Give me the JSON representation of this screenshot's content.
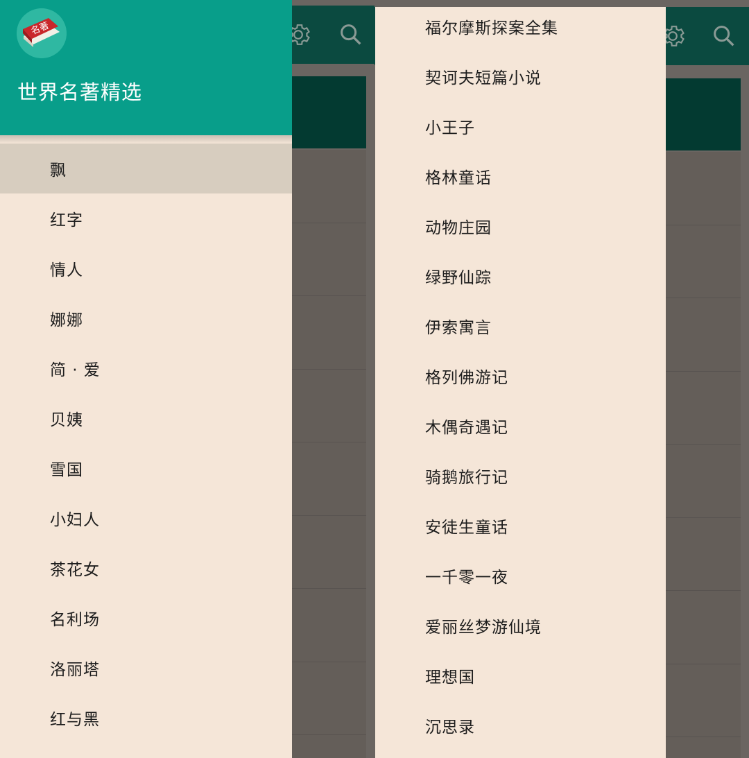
{
  "app": {
    "title": "世界名著精选",
    "logo_text": "名著"
  },
  "icons": {
    "settings": "gear-icon",
    "search": "search-icon",
    "logo": "book-icon"
  },
  "colors": {
    "header": "#089e8a",
    "drawer_bg": "#f5e6d8",
    "selected_bg": "#d7cdbf",
    "toolbar_dim": "#0b4a40"
  },
  "left_drawer": {
    "selected_index": 0,
    "items": [
      "飘",
      "红字",
      "情人",
      "娜娜",
      "简 · 爱",
      "贝姨",
      "雪国",
      "小妇人",
      "茶花女",
      "名利场",
      "洛丽塔",
      "红与黑"
    ]
  },
  "right_drawer": {
    "items": [
      "福尔摩斯探案全集",
      "契诃夫短篇小说",
      "小王子",
      "格林童话",
      "动物庄园",
      "绿野仙踪",
      "伊索寓言",
      "格列佛游记",
      "木偶奇遇记",
      "骑鹅旅行记",
      "安徒生童话",
      "一千零一夜",
      "爱丽丝梦游仙境",
      "理想国",
      "沉思录"
    ]
  }
}
